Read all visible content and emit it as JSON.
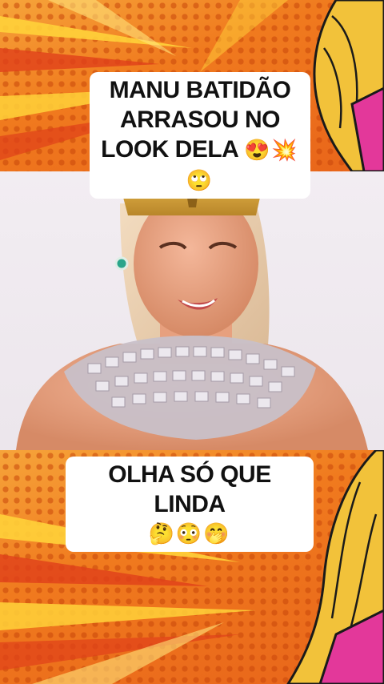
{
  "captions": {
    "top_text": "MANU BATIDÃO ARRASOU NO LOOK DELA",
    "top_emojis": "😍💥🙄",
    "bottom_text": "OLHA SÓ QUE LINDA",
    "bottom_emojis": "🤔😳🤭"
  },
  "colors": {
    "background_orange": "#f07a1e",
    "ray_yellow": "#ffd23a",
    "ray_red": "#e0401a",
    "hair_blonde": "#f2c23a",
    "shirt_pink": "#e3389a",
    "caption_bg": "#ffffff"
  },
  "scene": {
    "top_band": "pop-art-comic-rays",
    "photo": "woman-in-golden-headdress",
    "bottom_band": "pop-art-comic-rays"
  }
}
